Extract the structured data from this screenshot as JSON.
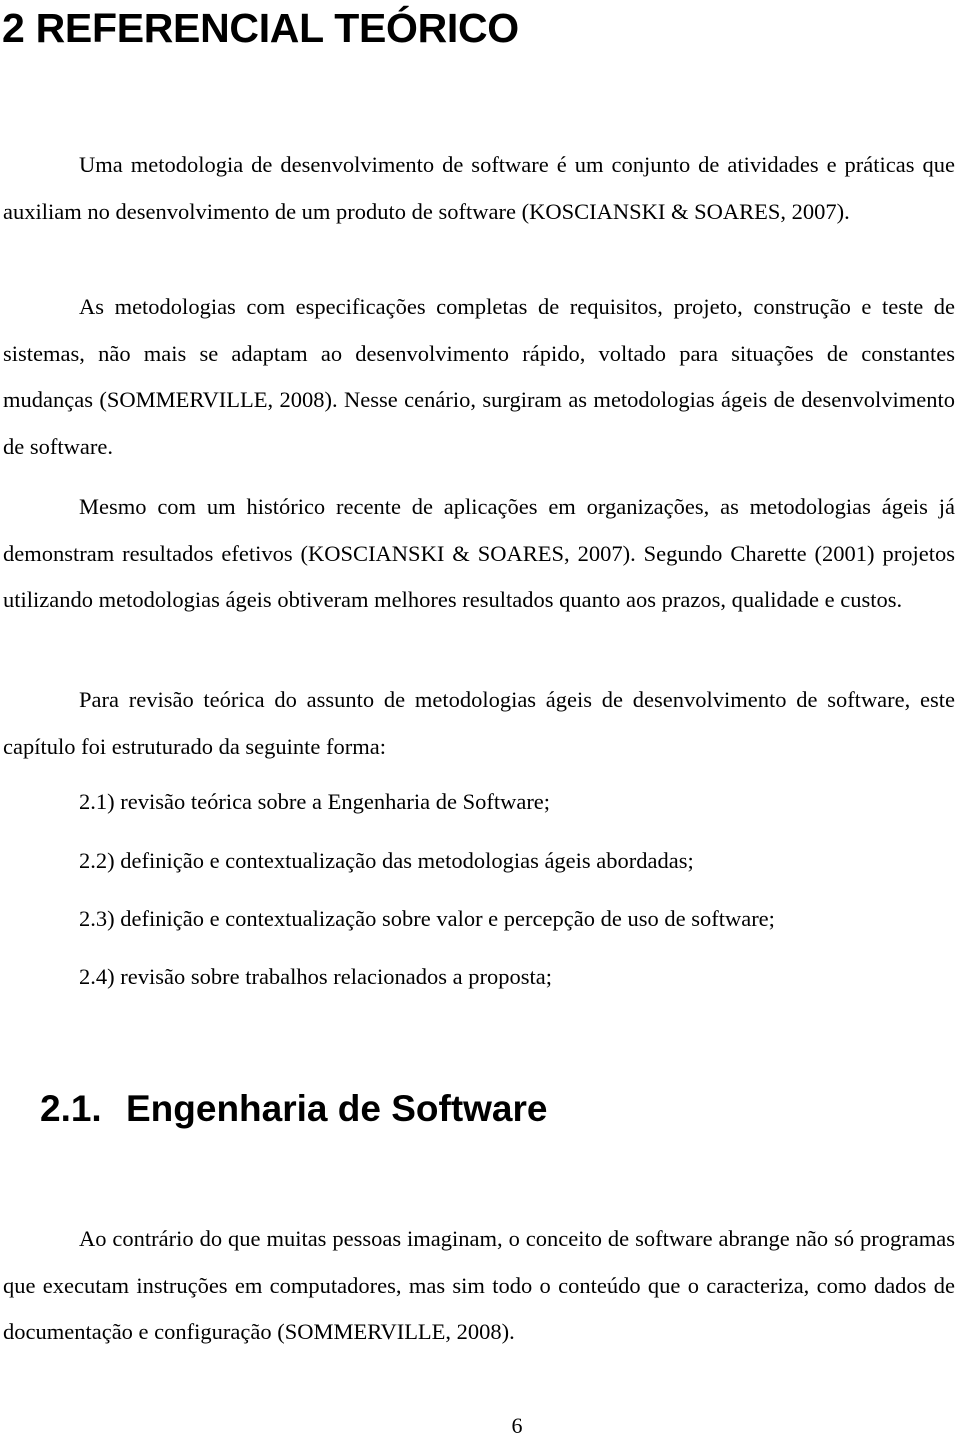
{
  "document": {
    "chapter_heading": "2 REFERENCIAL TEÓRICO",
    "paragraphs": [
      "Uma metodologia de desenvolvimento de software é um conjunto de atividades e práticas que auxiliam no desenvolvimento de um produto de software (KOSCIANSKI & SOARES, 2007).",
      "As metodologias com especificações completas de requisitos, projeto, construção e teste de sistemas, não mais se adaptam ao desenvolvimento rápido, voltado para situações de constantes mudanças (SOMMERVILLE, 2008). Nesse cenário, surgiram as metodologias ágeis de desenvolvimento de software.",
      "Mesmo com um histórico recente de aplicações em organizações, as metodologias ágeis já demonstram resultados efetivos (KOSCIANSKI & SOARES, 2007). Segundo Charette (2001) projetos utilizando metodologias ágeis obtiveram melhores resultados quanto aos prazos, qualidade e custos.",
      "Para revisão teórica do assunto de metodologias ágeis de desenvolvimento de software, este capítulo foi estruturado da seguinte forma:"
    ],
    "structure_list": [
      "2.1) revisão teórica sobre a Engenharia de Software;",
      "2.2) definição e contextualização das metodologias ágeis abordadas;",
      "2.3) definição e contextualização sobre valor e percepção de uso de software;",
      "2.4) revisão sobre trabalhos relacionados a proposta;"
    ],
    "section_heading": {
      "number": "2.1.",
      "title": "Engenharia de Software"
    },
    "section_paragraphs": [
      "Ao contrário do que muitas pessoas imaginam, o conceito de software abrange não só programas que executam instruções em computadores, mas sim todo o conteúdo que o caracteriza, como dados de documentação e configuração (SOMMERVILLE, 2008)."
    ],
    "page_number": "6"
  }
}
